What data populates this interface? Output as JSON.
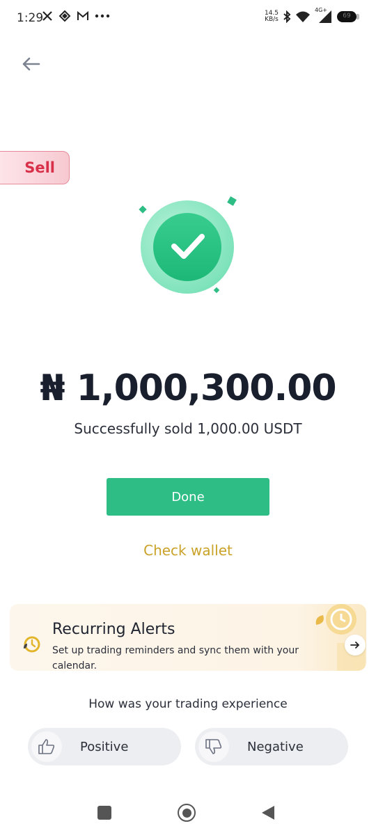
{
  "status_bar": {
    "time": "1:29",
    "net_speed_value": "14.5",
    "net_speed_unit": "KB/s",
    "network_label": "4G+",
    "battery": "69"
  },
  "sell_tag": {
    "label": "Sell"
  },
  "result": {
    "amount": "₦ 1,000,300.00",
    "message": "Successfully sold  1,000.00 USDT"
  },
  "actions": {
    "done_label": "Done",
    "check_wallet_label": "Check wallet"
  },
  "alert_card": {
    "title": "Recurring Alerts",
    "description": "Set up trading reminders and sync them with your calendar."
  },
  "feedback": {
    "question": "How was your trading experience",
    "positive_label": "Positive",
    "negative_label": "Negative"
  },
  "colors": {
    "success_green": "#2ebd85",
    "sell_red": "#d9304a",
    "wallet_gold": "#c9a227"
  }
}
